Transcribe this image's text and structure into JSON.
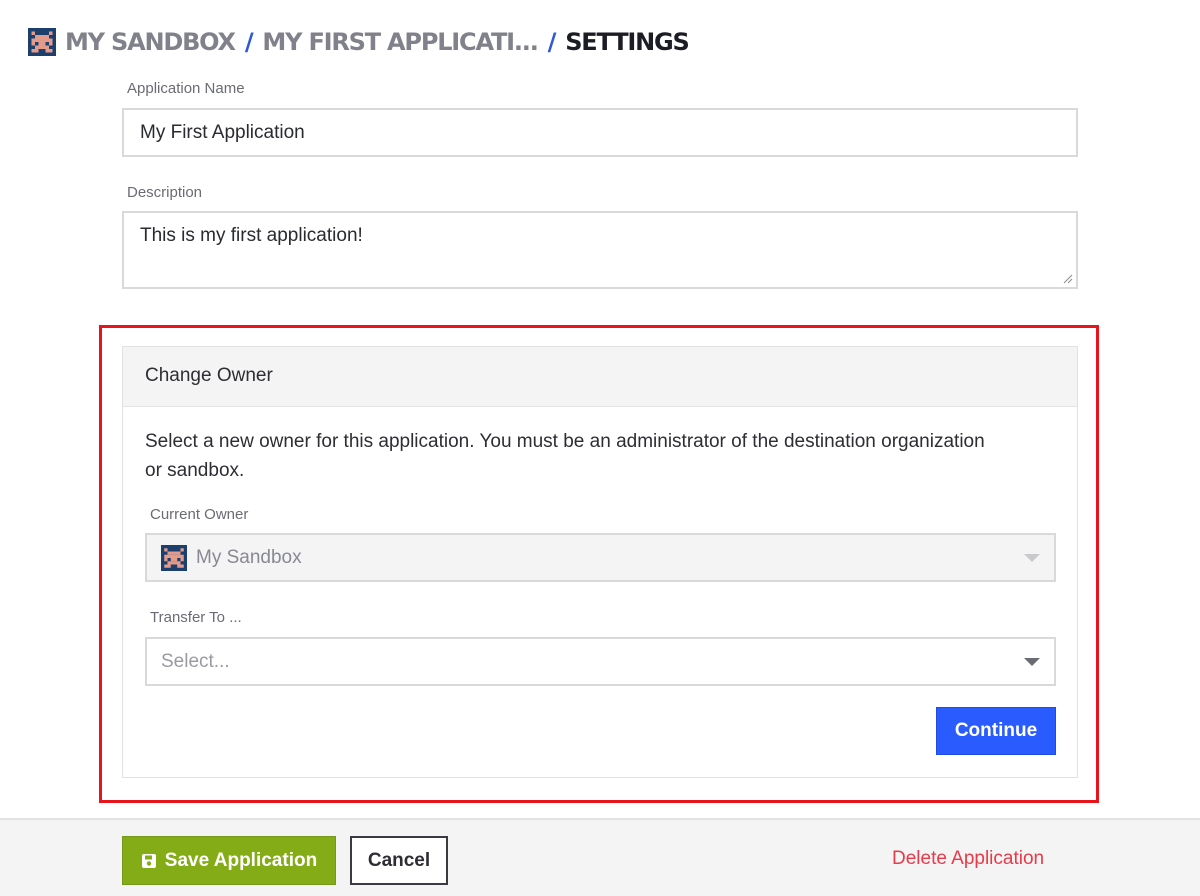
{
  "breadcrumb": {
    "items": [
      "MY SANDBOX",
      "MY FIRST APPLICATI...",
      "SETTINGS"
    ],
    "separator": "/"
  },
  "form": {
    "app_name_label": "Application Name",
    "app_name_value": "My First Application",
    "description_label": "Description",
    "description_value": "This is my first application!"
  },
  "change_owner": {
    "title": "Change Owner",
    "description": "Select a new owner for this application. You must be an administrator of the destination organization or sandbox.",
    "current_owner_label": "Current Owner",
    "current_owner_value": "My Sandbox",
    "transfer_to_label": "Transfer To ...",
    "transfer_to_placeholder": "Select...",
    "continue_label": "Continue"
  },
  "footer": {
    "save_label": "Save Application",
    "cancel_label": "Cancel",
    "delete_label": "Delete Application"
  },
  "colors": {
    "accent": "#2a5bff",
    "save": "#84ac17",
    "danger": "#e83a48",
    "highlight": "#e8141c"
  }
}
